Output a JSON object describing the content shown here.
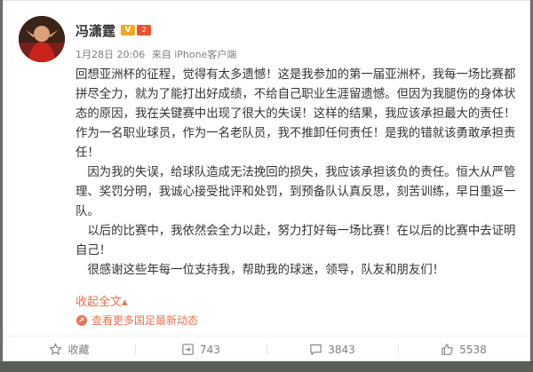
{
  "user": {
    "name": "冯潇霆",
    "badge_v": "V",
    "badge_level": "2"
  },
  "meta": {
    "date": "1月28日 20:06",
    "source": "来自 iPhone客户端"
  },
  "post": {
    "paragraphs": [
      "回想亚洲杯的征程，觉得有太多遗憾！这是我参加的第一届亚洲杯，我每一场比赛都拼尽全力，就为了能打出好成绩，不给自己职业生涯留遗憾。但因为我腿伤的身体状态的原因，我在关键赛中出现了很大的失误！这样的结果，我应该承担最大的责任！作为一名职业球员，作为一名老队员，我不推卸任何责任！是我的错就该勇敢承担责任！",
      "　因为我的失误，给球队造成无法挽回的损失，我应该承担该负的责任。恒大从严管理、奖罚分明，我诚心接受批评和处罚，到预备队认真反思，刻苦训练，早日重返一队。",
      "　以后的比赛中，我依然会全力以赴，努力打好每一场比赛！在以后的比赛中去证明自己！",
      "　很感谢这些年每一位支持我，帮助我的球迷，领导，队友和朋友们！"
    ],
    "collapse_label": "收起全文",
    "collapse_arrow": "▴",
    "more_link": "查看更多国足最新动态"
  },
  "actions": {
    "favorite": "收藏",
    "repost": "743",
    "comment": "3843",
    "like": "5538"
  },
  "colors": {
    "link": "#eb7350",
    "text": "#333333",
    "meta": "#808080"
  }
}
